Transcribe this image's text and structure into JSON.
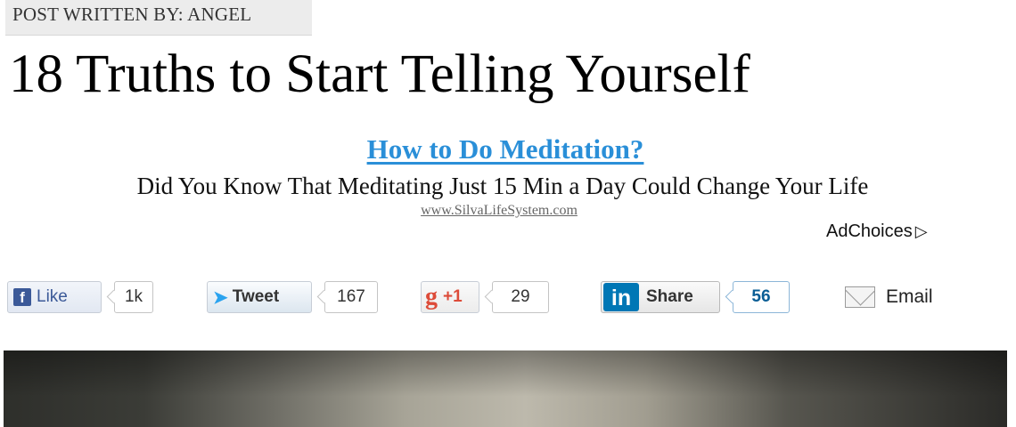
{
  "article": {
    "byline": "POST WRITTEN BY: ANGEL",
    "title": "18 Truths to Start Telling Yourself"
  },
  "ad": {
    "headline": "How to Do Meditation?",
    "body": "Did You Know That Meditating Just 15 Min a Day Could Change Your Life",
    "url": "www.SilvaLifeSystem.com",
    "adchoices_label": "AdChoices",
    "headline_color": "#2a8fd8"
  },
  "social": {
    "facebook": {
      "label": "Like",
      "count": "1k",
      "icon": "facebook-icon",
      "color": "#3b5998"
    },
    "twitter": {
      "label": "Tweet",
      "count": "167",
      "icon": "twitter-bird-icon",
      "color": "#2aa3ef"
    },
    "googleplus": {
      "label": "+1",
      "count": "29",
      "icon": "google-plus-icon",
      "color": "#dd4b39"
    },
    "linkedin": {
      "label": "Share",
      "count": "56",
      "icon": "linkedin-icon",
      "color": "#0077b5"
    },
    "email": {
      "label": "Email",
      "icon": "envelope-icon"
    }
  }
}
